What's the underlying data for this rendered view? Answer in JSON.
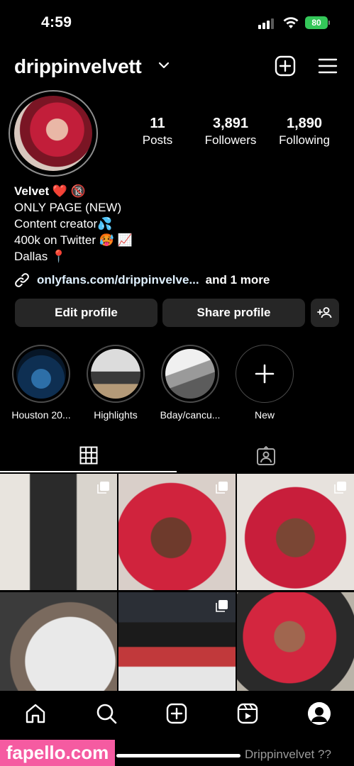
{
  "status_bar": {
    "time": "4:59",
    "battery": "80"
  },
  "header": {
    "username": "drippinvelvett"
  },
  "profile": {
    "stats": [
      {
        "value": "11",
        "label": "Posts"
      },
      {
        "value": "3,891",
        "label": "Followers"
      },
      {
        "value": "1,890",
        "label": "Following"
      }
    ],
    "bio": {
      "name": "Velvet ❤️ 🔞",
      "lines": [
        "ONLY PAGE (NEW)",
        "Content creator💦",
        "400k on Twitter 🥵 📈",
        "Dallas 📍"
      ]
    },
    "link": {
      "text": "onlyfans.com/drippinvelve...",
      "more": "and 1 more"
    }
  },
  "buttons": {
    "edit": "Edit profile",
    "share": "Share profile"
  },
  "highlights": [
    {
      "label": "Houston 20..."
    },
    {
      "label": "Highlights"
    },
    {
      "label": "Bday/cancu..."
    },
    {
      "label": "New"
    }
  ],
  "icons": {
    "header": [
      "chevron-down-icon",
      "add-post-icon",
      "menu-icon"
    ],
    "tabs": [
      "grid-icon",
      "tagged-icon"
    ],
    "nav": [
      "home-icon",
      "search-icon",
      "create-icon",
      "reels-icon",
      "profile-icon"
    ]
  },
  "colors": {
    "background": "#000000",
    "button": "#262626",
    "battery": "#34c759",
    "watermark": "#f55ba1"
  },
  "watermark": {
    "text": "fapello.com",
    "caption": "Drippinvelvet ??"
  }
}
